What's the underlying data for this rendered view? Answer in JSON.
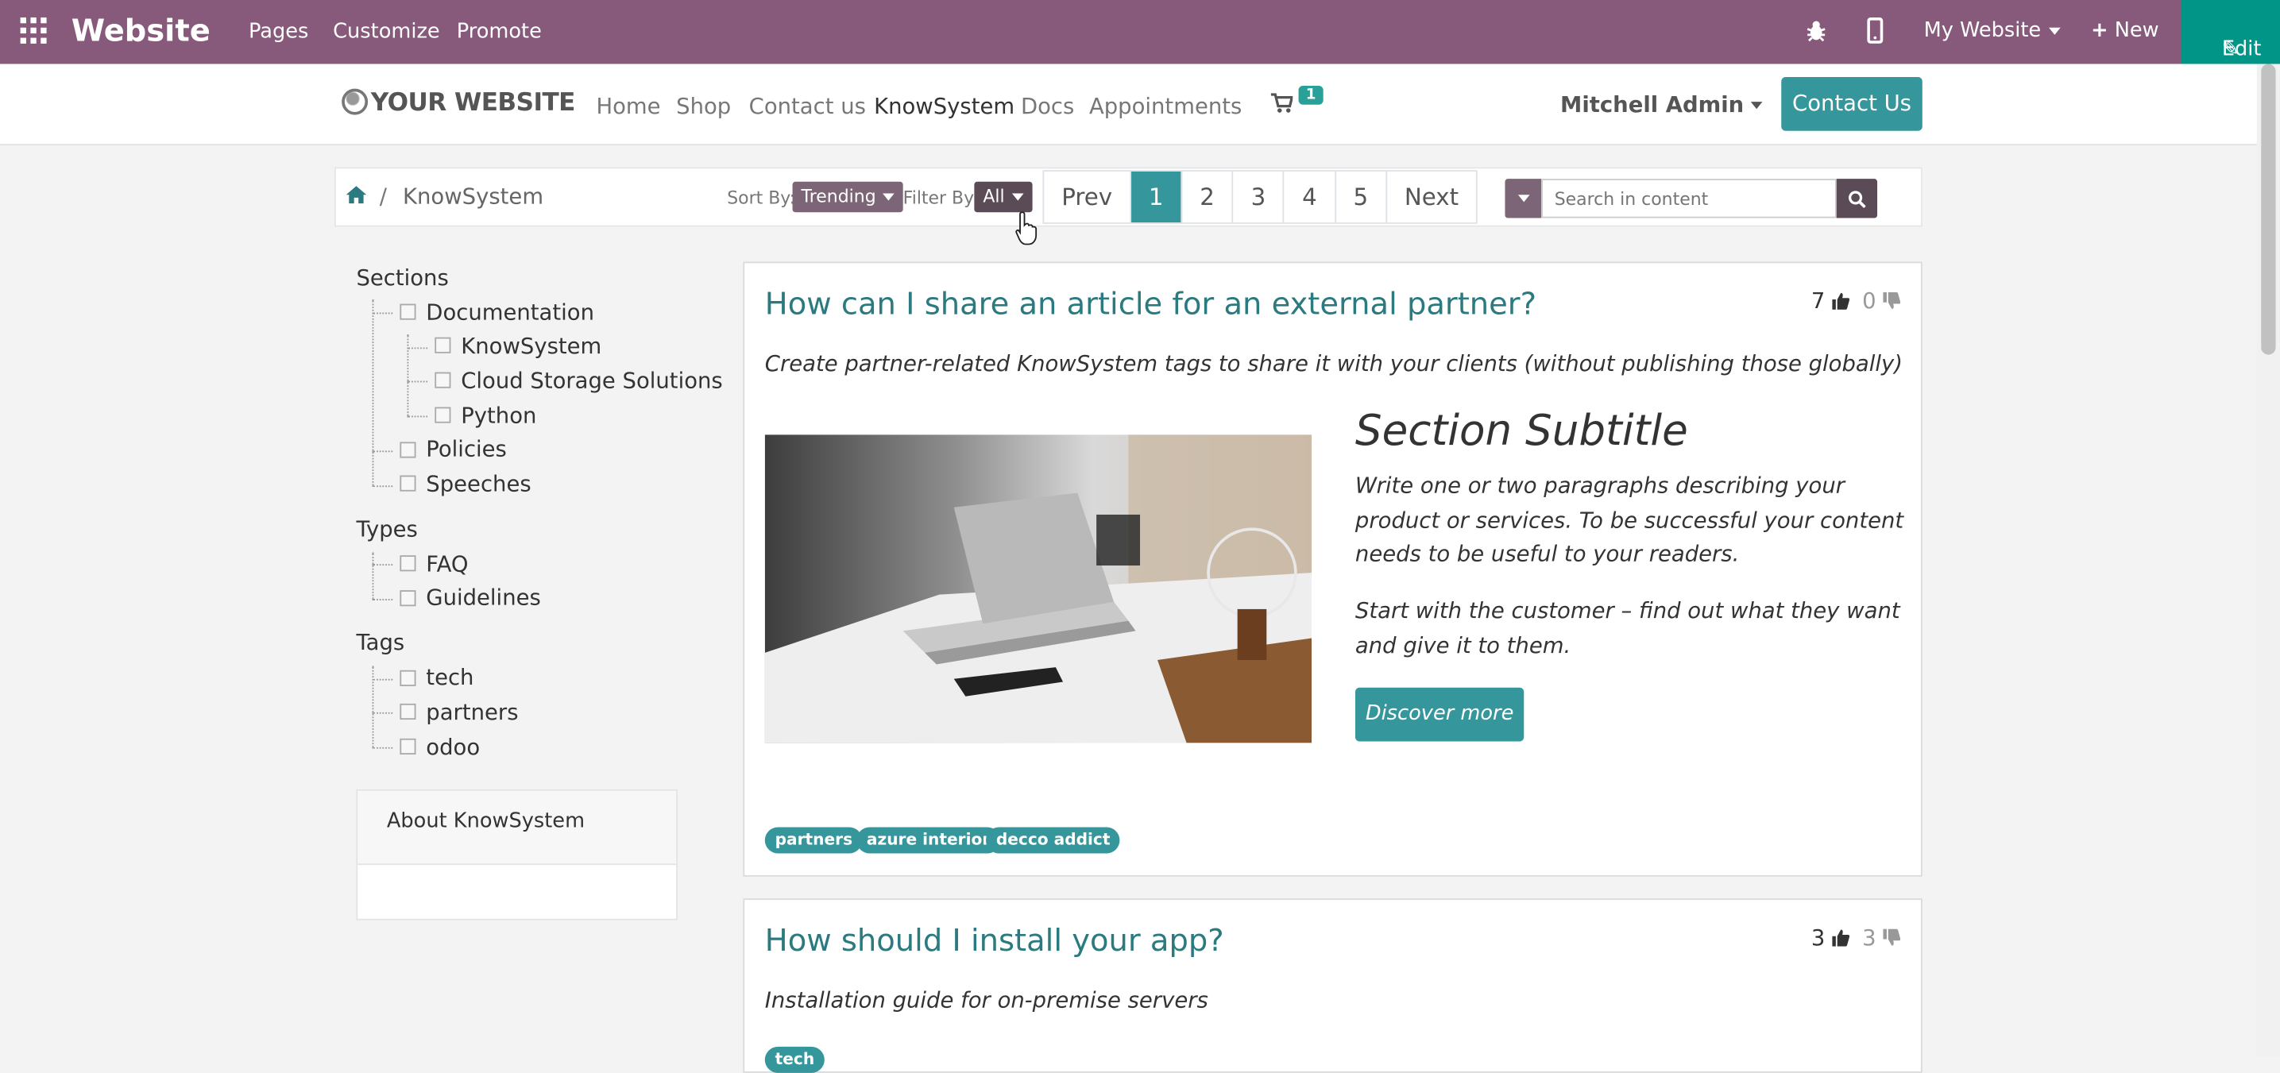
{
  "admin_bar": {
    "brand": "Website",
    "menu": [
      "Pages",
      "Customize",
      "Promote"
    ],
    "debug_icon": "bug-icon",
    "mobile_icon": "mobile-icon",
    "website_selector": "My Website",
    "new_label": "New",
    "edit_label": "Edit",
    "color": "#875a7b",
    "edit_color": "#019587"
  },
  "navbar": {
    "logo": "YOUR WEBSITE",
    "links": [
      "Home",
      "Shop",
      "Contact us",
      "KnowSystem",
      "Docs",
      "Appointments"
    ],
    "active_link": "KnowSystem",
    "cart_count": "1",
    "user": "Mitchell Admin",
    "contact_button": "Contact Us",
    "accent": "#35979c"
  },
  "toolbar": {
    "breadcrumb_sep": "/",
    "breadcrumb": "KnowSystem",
    "sort_label": "Sort By:",
    "sort_value": "Trending",
    "filter_label": "Filter By:",
    "filter_value": "All",
    "pager": [
      "Prev",
      "1",
      "2",
      "3",
      "4",
      "5",
      "Next"
    ],
    "current_page": "1",
    "search_placeholder": "Search in content"
  },
  "sidebar": {
    "sections_title": "Sections",
    "sections": [
      "Documentation",
      "KnowSystem",
      "Cloud Storage Solutions",
      "Python",
      "Policies",
      "Speeches"
    ],
    "types_title": "Types",
    "types": [
      "FAQ",
      "Guidelines"
    ],
    "tags_title": "Tags",
    "tags": [
      "tech",
      "partners",
      "odoo"
    ],
    "about_title": "About KnowSystem"
  },
  "articles": [
    {
      "title": "How can I share an article for an external partner?",
      "likes": "7",
      "dislikes": "0",
      "summary": "Create partner-related KnowSystem tags to share it with your clients (without publishing those globally)",
      "subtitle": "Section Subtitle",
      "para1": "Write one or two paragraphs describing your product or services. To be successful your content needs to be useful to your readers.",
      "para2": "Start with the customer – find out what they want and give it to them.",
      "button": "Discover more",
      "tags": [
        "partners",
        "azure interior",
        "decco addict"
      ]
    },
    {
      "title": "How should I install your app?",
      "likes": "3",
      "dislikes": "3",
      "summary": "Installation guide for on-premise servers",
      "tags": [
        "tech"
      ]
    }
  ]
}
